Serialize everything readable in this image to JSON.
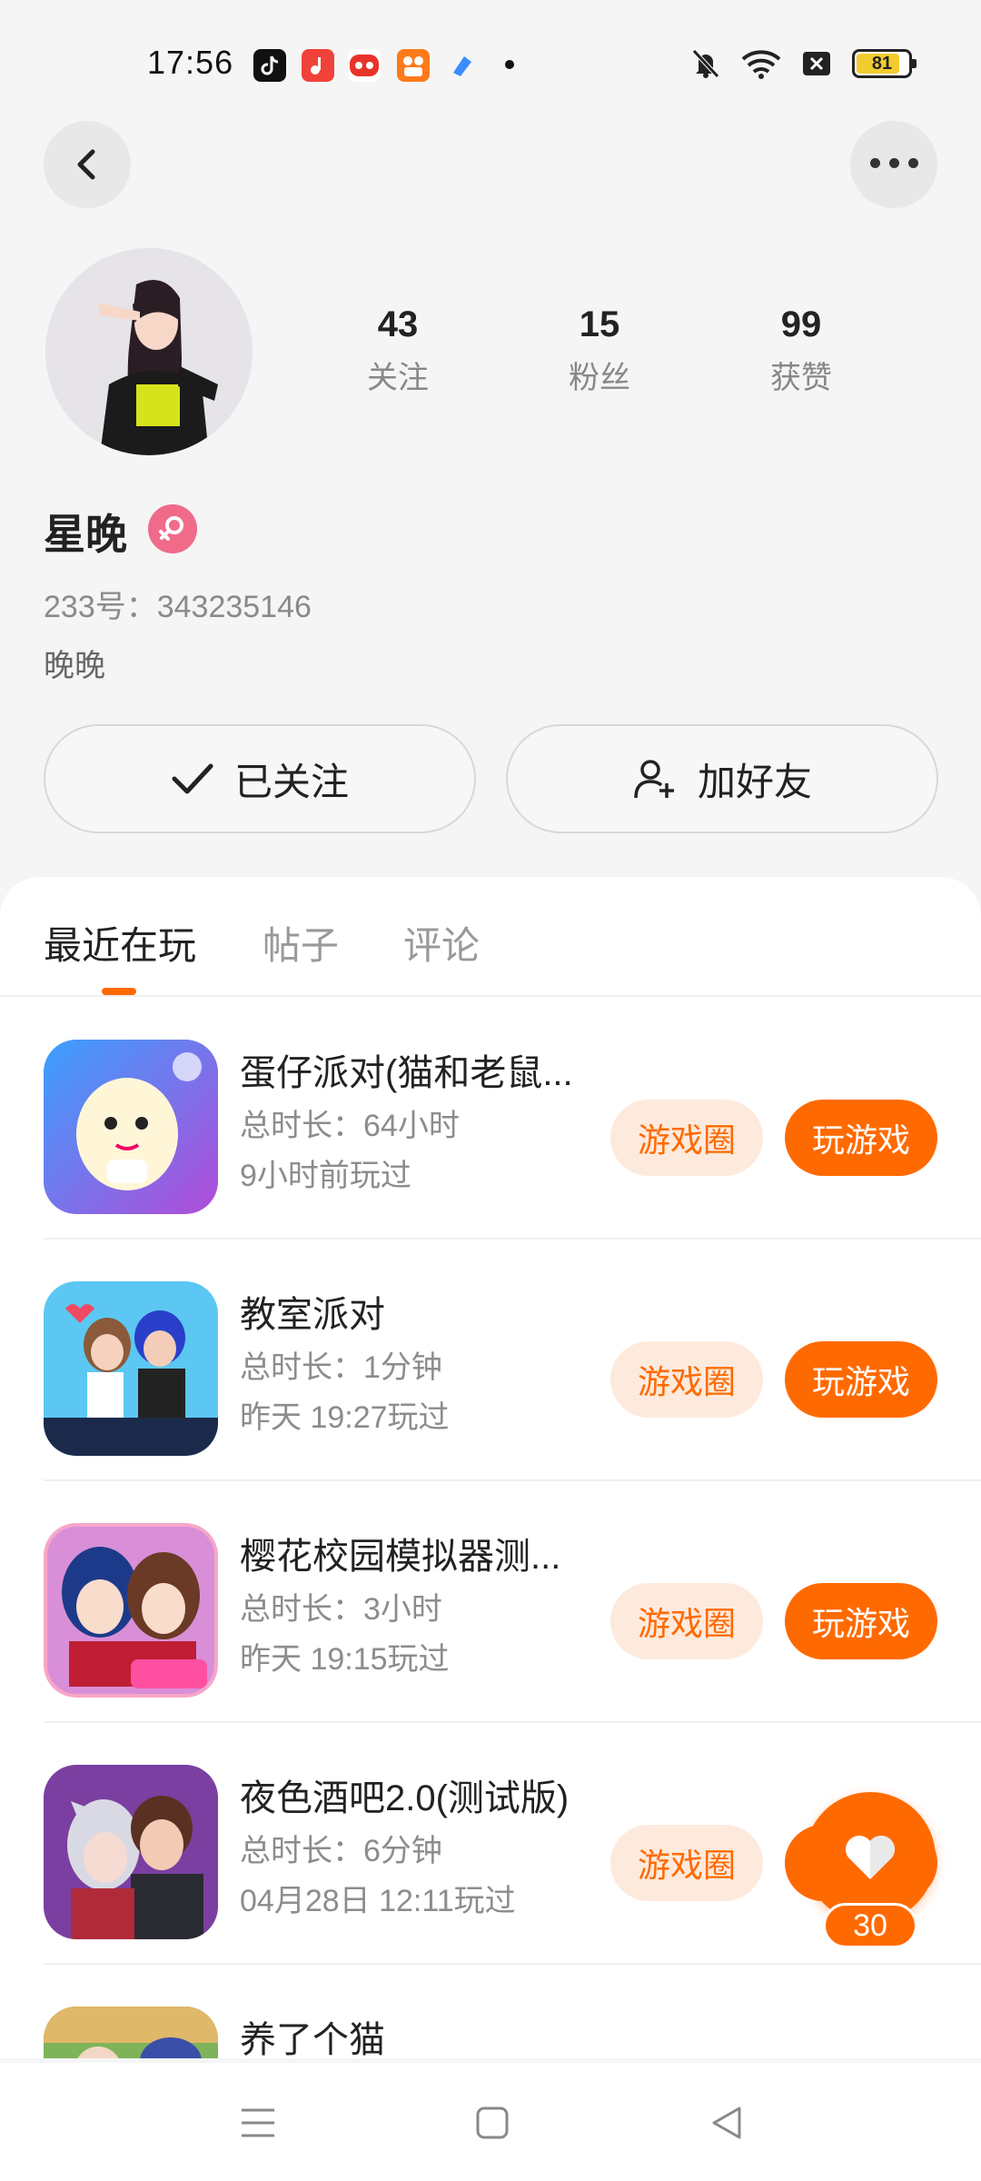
{
  "status_bar": {
    "time": "17:56",
    "app_icons": [
      "tiktok-icon",
      "music-icon",
      "red-app-icon",
      "kuaishou-icon",
      "blue-app-icon"
    ],
    "battery": "81"
  },
  "profile": {
    "following_count": "43",
    "following_label": "关注",
    "fans_count": "15",
    "fans_label": "粉丝",
    "likes_count": "99",
    "likes_label": "获赞",
    "name": "星晚",
    "uid": "233号：343235146",
    "bio": "晚晚",
    "follow_button": "已关注",
    "add_friend_button": "加好友"
  },
  "tabs": [
    "最近在玩",
    "帖子",
    "评论"
  ],
  "games": [
    {
      "title": "蛋仔派对(猫和老鼠...",
      "duration": "总时长：64小时",
      "last_played": "9小时前玩过",
      "circle_label": "游戏圈",
      "play_label": "玩游戏"
    },
    {
      "title": "教室派对",
      "duration": "总时长：1分钟",
      "last_played": "昨天 19:27玩过",
      "circle_label": "游戏圈",
      "play_label": "玩游戏"
    },
    {
      "title": "樱花校园模拟器测...",
      "duration": "总时长：3小时",
      "last_played": "昨天 19:15玩过",
      "circle_label": "游戏圈",
      "play_label": "玩游戏"
    },
    {
      "title": "夜色酒吧2.0(测试版)",
      "duration": "总时长：6分钟",
      "last_played": "04月28日 12:11玩过",
      "circle_label": "游戏圈",
      "play_label": ""
    },
    {
      "title": "养了个猫",
      "duration": "",
      "last_played": "",
      "circle_label": "",
      "play_label": ""
    }
  ],
  "like_fab": {
    "count": "30"
  },
  "colors": {
    "accent": "#ff6a00",
    "accent_light": "#fdeadd",
    "background": "#f5f5f6",
    "gender_female": "#f06b8a"
  }
}
